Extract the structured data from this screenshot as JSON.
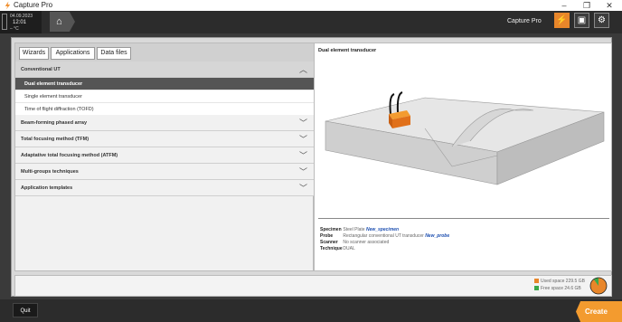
{
  "window": {
    "title": "Capture Pro",
    "minimize": "–",
    "maximize": "❐",
    "close": "✕"
  },
  "clock": {
    "date": "04.09.2023",
    "time": "12:01",
    "temp": "– °C"
  },
  "topbar": {
    "app_label": "Capture Pro"
  },
  "tabs": [
    "Wizards",
    "Applications",
    "Data files"
  ],
  "accordion": {
    "conventional": "Conventional UT",
    "items": [
      "Dual element transducer",
      "Single element transducer",
      "Time of flight diffraction (TOFD)"
    ],
    "groups": [
      "Beam-forming phased array",
      "Total focusing method (TFM)",
      "Adaptative total focusing method (ATFM)",
      "Multi-groups techniques",
      "Application templates"
    ]
  },
  "preview": {
    "title": "Dual element transducer",
    "specimen_label": "Specimen",
    "specimen_value": "Steel Plate",
    "specimen_name": "New_specimen",
    "probe_label": "Probe",
    "probe_value": "Rectangular conventional UT transducer",
    "probe_name": "New_probe",
    "scanner_label": "Scanner",
    "scanner_value": "No scanner associated",
    "technique_label": "Technique",
    "technique_value": "DUAL"
  },
  "storage": {
    "used": "Used space 229.5 GB",
    "free": "Free space 24.6 GB",
    "used_color": "#e8862a",
    "free_color": "#3aa84a",
    "used_fraction": 0.9
  },
  "footer": {
    "quit": "Quit",
    "create": "Create"
  }
}
